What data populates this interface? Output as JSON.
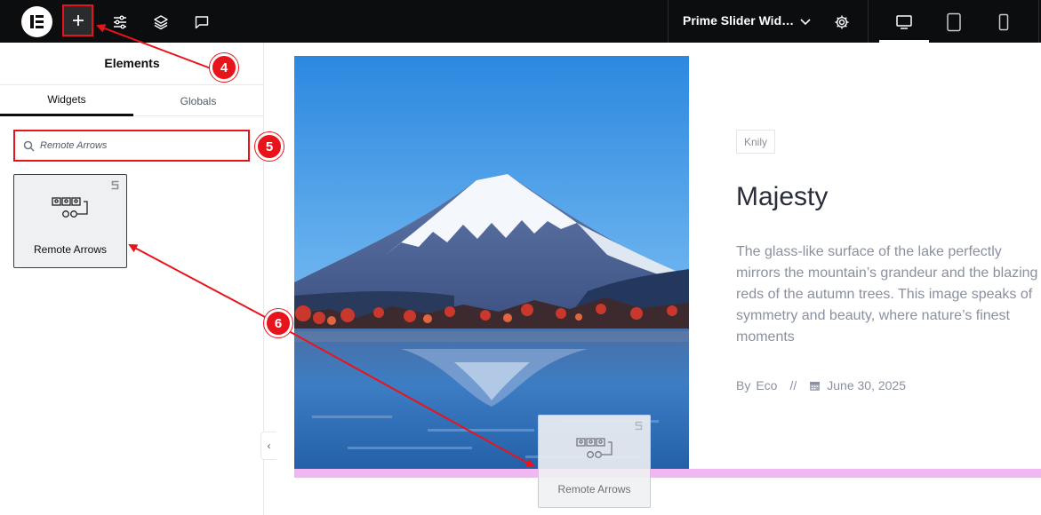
{
  "topbar": {
    "page_name": "Prime Slider Wid…",
    "icons": [
      "elementor-logo-icon",
      "plus-icon",
      "sliders-icon",
      "layers-icon",
      "comment-icon",
      "chevron-down-icon",
      "gear-icon",
      "desktop-icon",
      "tablet-icon",
      "mobile-icon"
    ]
  },
  "sidebar": {
    "title": "Elements",
    "tabs": [
      {
        "label": "Widgets",
        "active": true
      },
      {
        "label": "Globals",
        "active": false
      }
    ],
    "search": {
      "value": "Remote Arrows",
      "placeholder": ""
    },
    "widgets": [
      {
        "label": "Remote Arrows",
        "icon": "remote-arrows-icon",
        "pro_badge": "pro-icon"
      }
    ]
  },
  "canvas": {
    "badge": "Knily",
    "headline": "Majesty",
    "description": "The glass-like surface of the lake perfectly mirrors the mountain’s grandeur and the blazing reds of the autumn trees. This image speaks of symmetry and beauty, where nature’s finest moments",
    "meta": {
      "by": "By",
      "author": "Eco",
      "separator": "//",
      "date": "June 30, 2025"
    },
    "dragged_widget": "Remote Arrows"
  },
  "annotations": [
    "4",
    "5",
    "6"
  ],
  "colors": {
    "accent_red": "#e8141c",
    "topbar_bg": "#0c0d0e",
    "pink_drop_zone": "#f1b7f3"
  }
}
